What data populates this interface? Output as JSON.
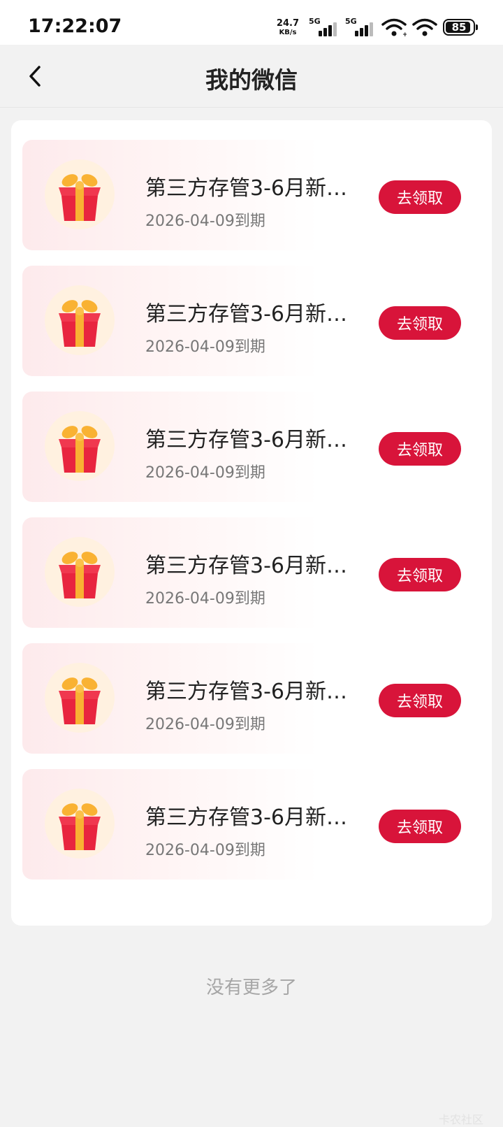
{
  "status_bar": {
    "time": "17:22:07",
    "net_speed_value": "24.7",
    "net_speed_unit": "KB/s",
    "sim1_label": "5G",
    "sim2_label": "5G",
    "battery": "85"
  },
  "nav": {
    "back_icon": "chevron-left-icon",
    "title": "我的微信"
  },
  "coupons": [
    {
      "title": "第三方存管3-6月新…",
      "expiry": "2026-04-09到期",
      "button": "去领取"
    },
    {
      "title": "第三方存管3-6月新…",
      "expiry": "2026-04-09到期",
      "button": "去领取"
    },
    {
      "title": "第三方存管3-6月新…",
      "expiry": "2026-04-09到期",
      "button": "去领取"
    },
    {
      "title": "第三方存管3-6月新…",
      "expiry": "2026-04-09到期",
      "button": "去领取"
    },
    {
      "title": "第三方存管3-6月新…",
      "expiry": "2026-04-09到期",
      "button": "去领取"
    },
    {
      "title": "第三方存管3-6月新…",
      "expiry": "2026-04-09到期",
      "button": "去领取"
    }
  ],
  "footer": {
    "no_more": "没有更多了",
    "watermark": "卡农社区"
  },
  "colors": {
    "accent": "#d8143a",
    "background": "#f2f2f2",
    "gift_red": "#e8253f",
    "gift_ribbon": "#f9b233"
  }
}
